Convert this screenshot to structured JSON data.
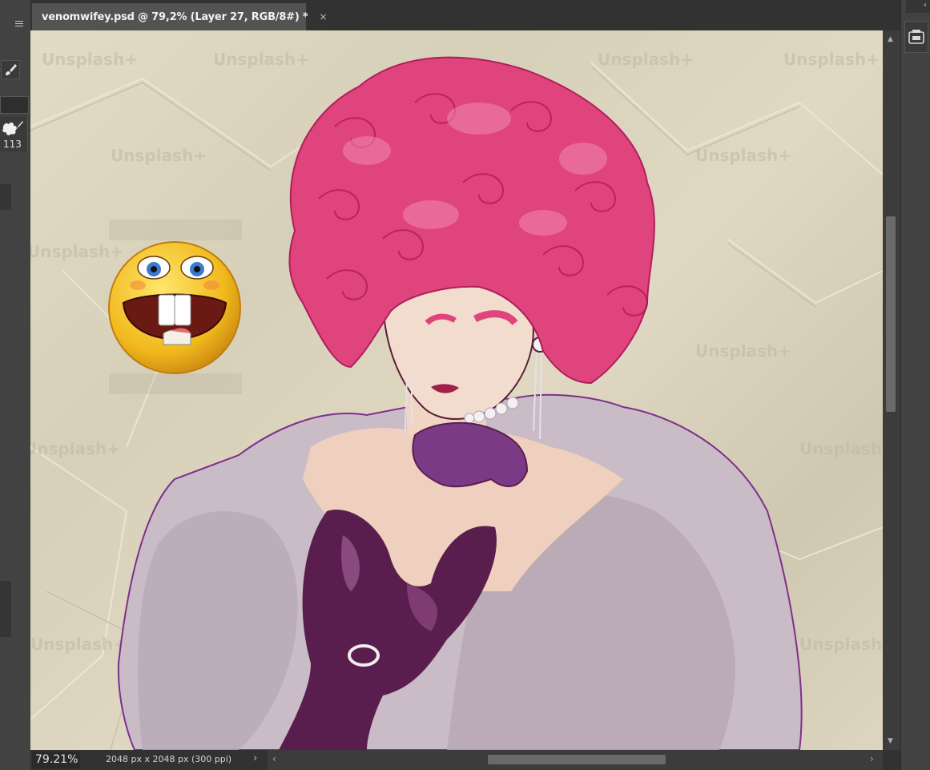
{
  "document": {
    "tab_title": "venomwifey.psd @ 79,2% (Layer 27, RGB/8#) *",
    "close_glyph": "×"
  },
  "toolbar": {
    "brush_size": "113"
  },
  "canvas": {
    "watermark": "Unsplash+"
  },
  "status": {
    "zoom": "79.21%",
    "doc_info": "2048 px x 2048 px (300 ppi)",
    "info_arrow": "›"
  },
  "colors": {
    "hair": "#e0447c",
    "dress": "#5a1e4e",
    "glove": "#7b3a86",
    "fur": "#c7b9c6",
    "paper": "#ddd6c0",
    "emoji_face": "#f0b81c"
  },
  "icons": [
    "menu-icon",
    "brush-icon",
    "brush-preset-icon",
    "close-icon",
    "library-icon",
    "scroll-up-icon",
    "scroll-down-icon",
    "scroll-left-icon",
    "scroll-right-icon",
    "collapse-icon"
  ]
}
